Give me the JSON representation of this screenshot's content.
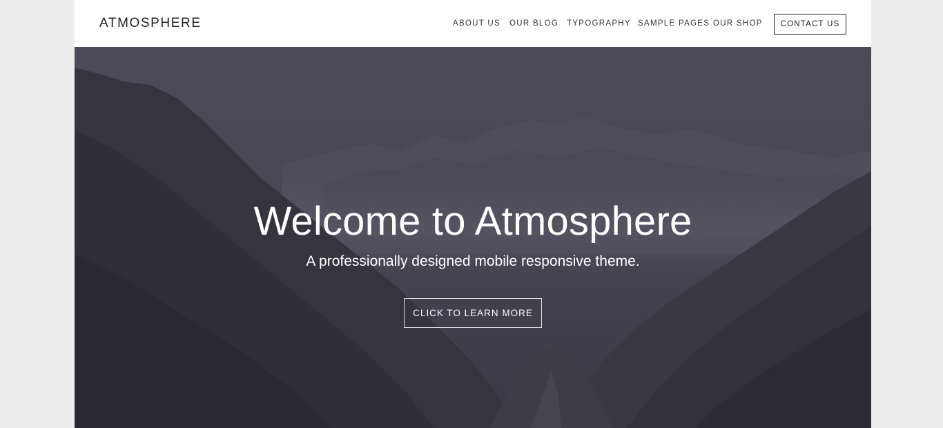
{
  "site": {
    "title": "ATMOSPHERE"
  },
  "nav": {
    "items": [
      {
        "label": "ABOUT US"
      },
      {
        "label": "OUR BLOG"
      },
      {
        "label": "TYPOGRAPHY"
      },
      {
        "label": "SAMPLE PAGES"
      },
      {
        "label": "OUR SHOP"
      }
    ],
    "contact_label": "CONTACT US"
  },
  "hero": {
    "title": "Welcome to Atmosphere",
    "subtitle": "A professionally designed mobile responsive theme.",
    "cta_label": "CLICK TO LEARN MORE"
  },
  "colors": {
    "page_background": "#ededed",
    "header_background": "#ffffff",
    "hero_overlay": "#4a4854",
    "text_dark": "#222222",
    "text_light": "#ffffff"
  }
}
